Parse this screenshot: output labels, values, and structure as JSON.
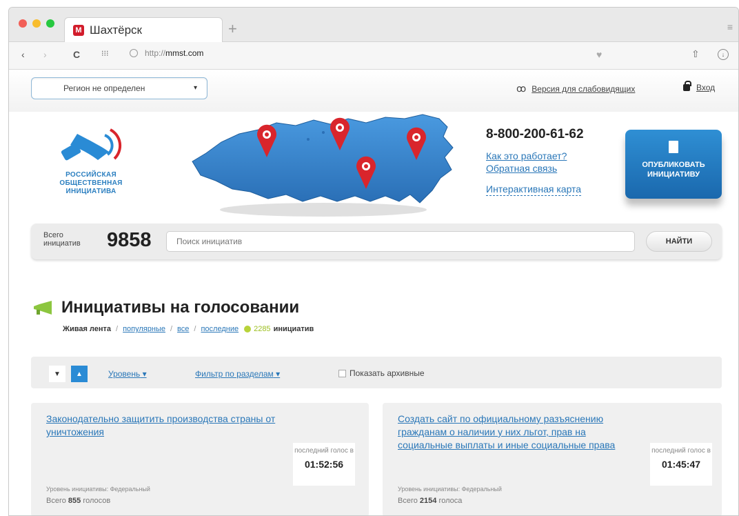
{
  "browser": {
    "tab_title": "Шахтёрск",
    "favicon": "М",
    "url_prefix": "http://",
    "url_host": "mmst.com"
  },
  "top": {
    "region_label": "Регион не определен",
    "accessibility_label": "Версия для слабовидящих",
    "login_label": "Вход"
  },
  "header": {
    "logo_lines": [
      "РОССИЙСКАЯ",
      "ОБЩЕСТВЕННАЯ",
      "ИНИЦИАТИВА"
    ],
    "phone": "8-800-200-61-62",
    "how_it_works": "Как это работает?",
    "feedback": "Обратная связь",
    "interactive_map": "Интерактивная карта",
    "publish_line1": "ОПУБЛИКОВАТЬ",
    "publish_line2": "ИНИЦИАТИВУ"
  },
  "search": {
    "total_label_1": "Всего",
    "total_label_2": "инициатив",
    "total_count": "9858",
    "placeholder": "Поиск инициатив",
    "button": "НАЙТИ"
  },
  "section": {
    "title": "Инициативы на голосовании",
    "live": "Живая лента",
    "popular": "популярные",
    "all": "все",
    "latest": "последние",
    "count": "2285",
    "count_word": "инициатив"
  },
  "filter": {
    "level": "Уровень",
    "by_sections": "Фильтр по разделам",
    "show_archived": "Показать архивные"
  },
  "cards": [
    {
      "title": "Законодательно защитить производства страны от уничтожения",
      "last_vote_label": "последний голос в",
      "last_vote_time": "01:52:56",
      "level": "Уровень инициативы: Федеральный",
      "votes_prefix": "Всего",
      "votes": "855",
      "votes_suffix": "голосов"
    },
    {
      "title": "Создать сайт по официальному разъяснению гражданам о наличии у них льгот, прав на социальные выплаты и иные социальные права",
      "last_vote_label": "последний голос в",
      "last_vote_time": "01:45:47",
      "level": "Уровень инициативы: Федеральный",
      "votes_prefix": "Всего",
      "votes": "2154",
      "votes_suffix": "голоса"
    }
  ],
  "colors": {
    "accent_blue": "#2a77b8",
    "button_blue": "#1f78c1",
    "pin_red": "#d9252c",
    "feed_green": "#b8d33a"
  }
}
